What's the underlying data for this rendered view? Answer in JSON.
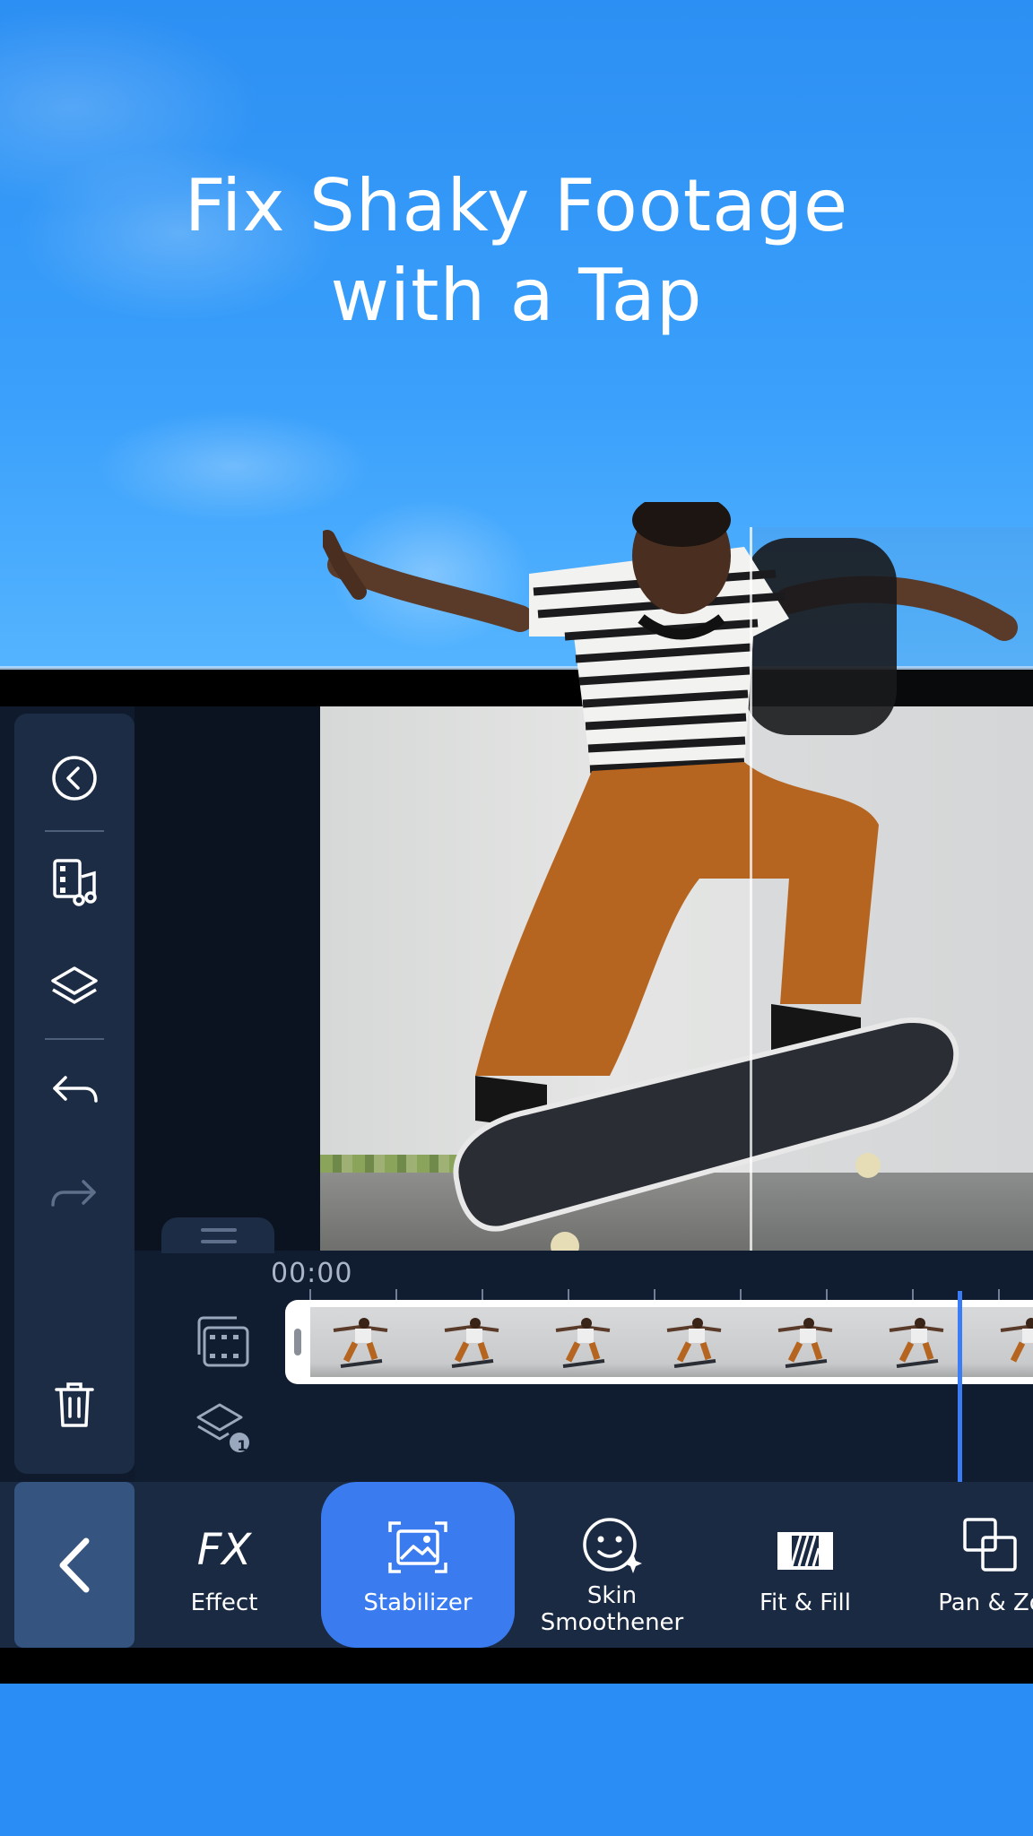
{
  "headline": {
    "line1": "Fix Shaky Footage",
    "line2": "with a Tap"
  },
  "sidebar": {
    "items": [
      {
        "icon": "back-circle-icon"
      },
      {
        "icon": "media-music-icon"
      },
      {
        "icon": "layers-icon"
      },
      {
        "icon": "undo-icon"
      },
      {
        "icon": "redo-icon"
      },
      {
        "icon": "trash-icon"
      }
    ]
  },
  "timeline": {
    "timecode": "00:00",
    "overlay_layer_count": "1"
  },
  "toolbar": {
    "items": [
      {
        "label": "Effect",
        "icon": "fx-icon",
        "active": false
      },
      {
        "label": "Stabilizer",
        "icon": "stabilizer-icon",
        "active": true
      },
      {
        "label": "Skin\nSmoothener",
        "icon": "skin-smoothener-icon",
        "active": false
      },
      {
        "label": "Fit & Fill",
        "icon": "fit-fill-icon",
        "active": false
      },
      {
        "label": "Pan & Zo",
        "icon": "pan-zoom-icon",
        "active": false
      }
    ]
  },
  "colors": {
    "sky": "#2c8ff3",
    "app_background": "#0f1a2c",
    "panel": "#1c2c44",
    "accent": "#3a7cf0",
    "playhead": "#3a7cf5"
  }
}
